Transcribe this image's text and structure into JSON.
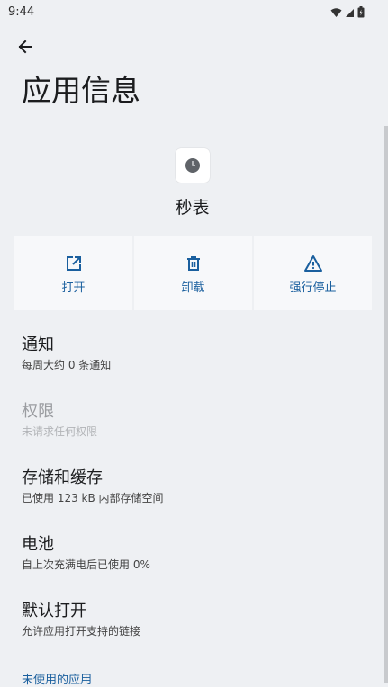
{
  "status": {
    "time": "9:44"
  },
  "header": {
    "title": "应用信息"
  },
  "app": {
    "name": "秒表"
  },
  "actions": [
    {
      "label": "打开",
      "icon": "open-in-new-icon"
    },
    {
      "label": "卸载",
      "icon": "trash-icon"
    },
    {
      "label": "强行停止",
      "icon": "warning-icon"
    }
  ],
  "settings": [
    {
      "title": "通知",
      "subtitle": "每周大约 0 条通知",
      "enabled": true
    },
    {
      "title": "权限",
      "subtitle": "未请求任何权限",
      "enabled": false
    },
    {
      "title": "存储和缓存",
      "subtitle": "已使用 123 kB 内部存储空间",
      "enabled": true
    },
    {
      "title": "电池",
      "subtitle": "自上次充满电后已使用 0%",
      "enabled": true
    },
    {
      "title": "默认打开",
      "subtitle": "允许应用打开支持的链接",
      "enabled": true
    }
  ],
  "section_link": "未使用的应用",
  "colors": {
    "accent": "#1a5f9e",
    "background": "#eef0f3",
    "card": "#f7f8fa"
  }
}
